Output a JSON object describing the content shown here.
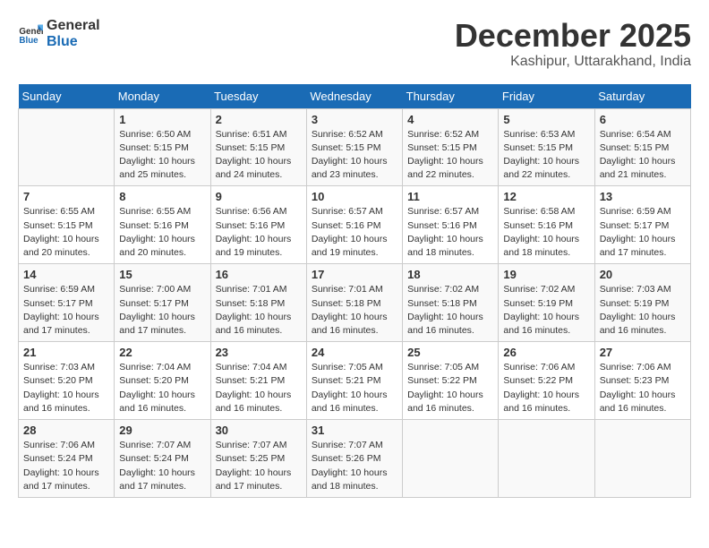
{
  "header": {
    "logo_line1": "General",
    "logo_line2": "Blue",
    "month": "December 2025",
    "location": "Kashipur, Uttarakhand, India"
  },
  "weekdays": [
    "Sunday",
    "Monday",
    "Tuesday",
    "Wednesday",
    "Thursday",
    "Friday",
    "Saturday"
  ],
  "weeks": [
    [
      {
        "day": "",
        "info": ""
      },
      {
        "day": "1",
        "info": "Sunrise: 6:50 AM\nSunset: 5:15 PM\nDaylight: 10 hours\nand 25 minutes."
      },
      {
        "day": "2",
        "info": "Sunrise: 6:51 AM\nSunset: 5:15 PM\nDaylight: 10 hours\nand 24 minutes."
      },
      {
        "day": "3",
        "info": "Sunrise: 6:52 AM\nSunset: 5:15 PM\nDaylight: 10 hours\nand 23 minutes."
      },
      {
        "day": "4",
        "info": "Sunrise: 6:52 AM\nSunset: 5:15 PM\nDaylight: 10 hours\nand 22 minutes."
      },
      {
        "day": "5",
        "info": "Sunrise: 6:53 AM\nSunset: 5:15 PM\nDaylight: 10 hours\nand 22 minutes."
      },
      {
        "day": "6",
        "info": "Sunrise: 6:54 AM\nSunset: 5:15 PM\nDaylight: 10 hours\nand 21 minutes."
      }
    ],
    [
      {
        "day": "7",
        "info": "Sunrise: 6:55 AM\nSunset: 5:15 PM\nDaylight: 10 hours\nand 20 minutes."
      },
      {
        "day": "8",
        "info": "Sunrise: 6:55 AM\nSunset: 5:16 PM\nDaylight: 10 hours\nand 20 minutes."
      },
      {
        "day": "9",
        "info": "Sunrise: 6:56 AM\nSunset: 5:16 PM\nDaylight: 10 hours\nand 19 minutes."
      },
      {
        "day": "10",
        "info": "Sunrise: 6:57 AM\nSunset: 5:16 PM\nDaylight: 10 hours\nand 19 minutes."
      },
      {
        "day": "11",
        "info": "Sunrise: 6:57 AM\nSunset: 5:16 PM\nDaylight: 10 hours\nand 18 minutes."
      },
      {
        "day": "12",
        "info": "Sunrise: 6:58 AM\nSunset: 5:16 PM\nDaylight: 10 hours\nand 18 minutes."
      },
      {
        "day": "13",
        "info": "Sunrise: 6:59 AM\nSunset: 5:17 PM\nDaylight: 10 hours\nand 17 minutes."
      }
    ],
    [
      {
        "day": "14",
        "info": "Sunrise: 6:59 AM\nSunset: 5:17 PM\nDaylight: 10 hours\nand 17 minutes."
      },
      {
        "day": "15",
        "info": "Sunrise: 7:00 AM\nSunset: 5:17 PM\nDaylight: 10 hours\nand 17 minutes."
      },
      {
        "day": "16",
        "info": "Sunrise: 7:01 AM\nSunset: 5:18 PM\nDaylight: 10 hours\nand 16 minutes."
      },
      {
        "day": "17",
        "info": "Sunrise: 7:01 AM\nSunset: 5:18 PM\nDaylight: 10 hours\nand 16 minutes."
      },
      {
        "day": "18",
        "info": "Sunrise: 7:02 AM\nSunset: 5:18 PM\nDaylight: 10 hours\nand 16 minutes."
      },
      {
        "day": "19",
        "info": "Sunrise: 7:02 AM\nSunset: 5:19 PM\nDaylight: 10 hours\nand 16 minutes."
      },
      {
        "day": "20",
        "info": "Sunrise: 7:03 AM\nSunset: 5:19 PM\nDaylight: 10 hours\nand 16 minutes."
      }
    ],
    [
      {
        "day": "21",
        "info": "Sunrise: 7:03 AM\nSunset: 5:20 PM\nDaylight: 10 hours\nand 16 minutes."
      },
      {
        "day": "22",
        "info": "Sunrise: 7:04 AM\nSunset: 5:20 PM\nDaylight: 10 hours\nand 16 minutes."
      },
      {
        "day": "23",
        "info": "Sunrise: 7:04 AM\nSunset: 5:21 PM\nDaylight: 10 hours\nand 16 minutes."
      },
      {
        "day": "24",
        "info": "Sunrise: 7:05 AM\nSunset: 5:21 PM\nDaylight: 10 hours\nand 16 minutes."
      },
      {
        "day": "25",
        "info": "Sunrise: 7:05 AM\nSunset: 5:22 PM\nDaylight: 10 hours\nand 16 minutes."
      },
      {
        "day": "26",
        "info": "Sunrise: 7:06 AM\nSunset: 5:22 PM\nDaylight: 10 hours\nand 16 minutes."
      },
      {
        "day": "27",
        "info": "Sunrise: 7:06 AM\nSunset: 5:23 PM\nDaylight: 10 hours\nand 16 minutes."
      }
    ],
    [
      {
        "day": "28",
        "info": "Sunrise: 7:06 AM\nSunset: 5:24 PM\nDaylight: 10 hours\nand 17 minutes."
      },
      {
        "day": "29",
        "info": "Sunrise: 7:07 AM\nSunset: 5:24 PM\nDaylight: 10 hours\nand 17 minutes."
      },
      {
        "day": "30",
        "info": "Sunrise: 7:07 AM\nSunset: 5:25 PM\nDaylight: 10 hours\nand 17 minutes."
      },
      {
        "day": "31",
        "info": "Sunrise: 7:07 AM\nSunset: 5:26 PM\nDaylight: 10 hours\nand 18 minutes."
      },
      {
        "day": "",
        "info": ""
      },
      {
        "day": "",
        "info": ""
      },
      {
        "day": "",
        "info": ""
      }
    ]
  ]
}
